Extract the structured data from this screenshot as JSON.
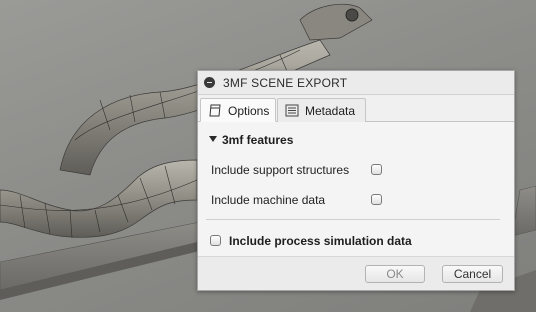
{
  "dialog": {
    "title": "3MF SCENE EXPORT",
    "tabs": [
      {
        "label": "Options",
        "icon": "options-icon"
      },
      {
        "label": "Metadata",
        "icon": "metadata-icon"
      }
    ],
    "section": {
      "title": "3mf features",
      "options": [
        {
          "label": "Include support structures",
          "checked": false
        },
        {
          "label": "Include machine data",
          "checked": false
        }
      ]
    },
    "process_simulation_label": "Include process simulation data",
    "buttons": {
      "ok": "OK",
      "cancel": "Cancel"
    }
  }
}
